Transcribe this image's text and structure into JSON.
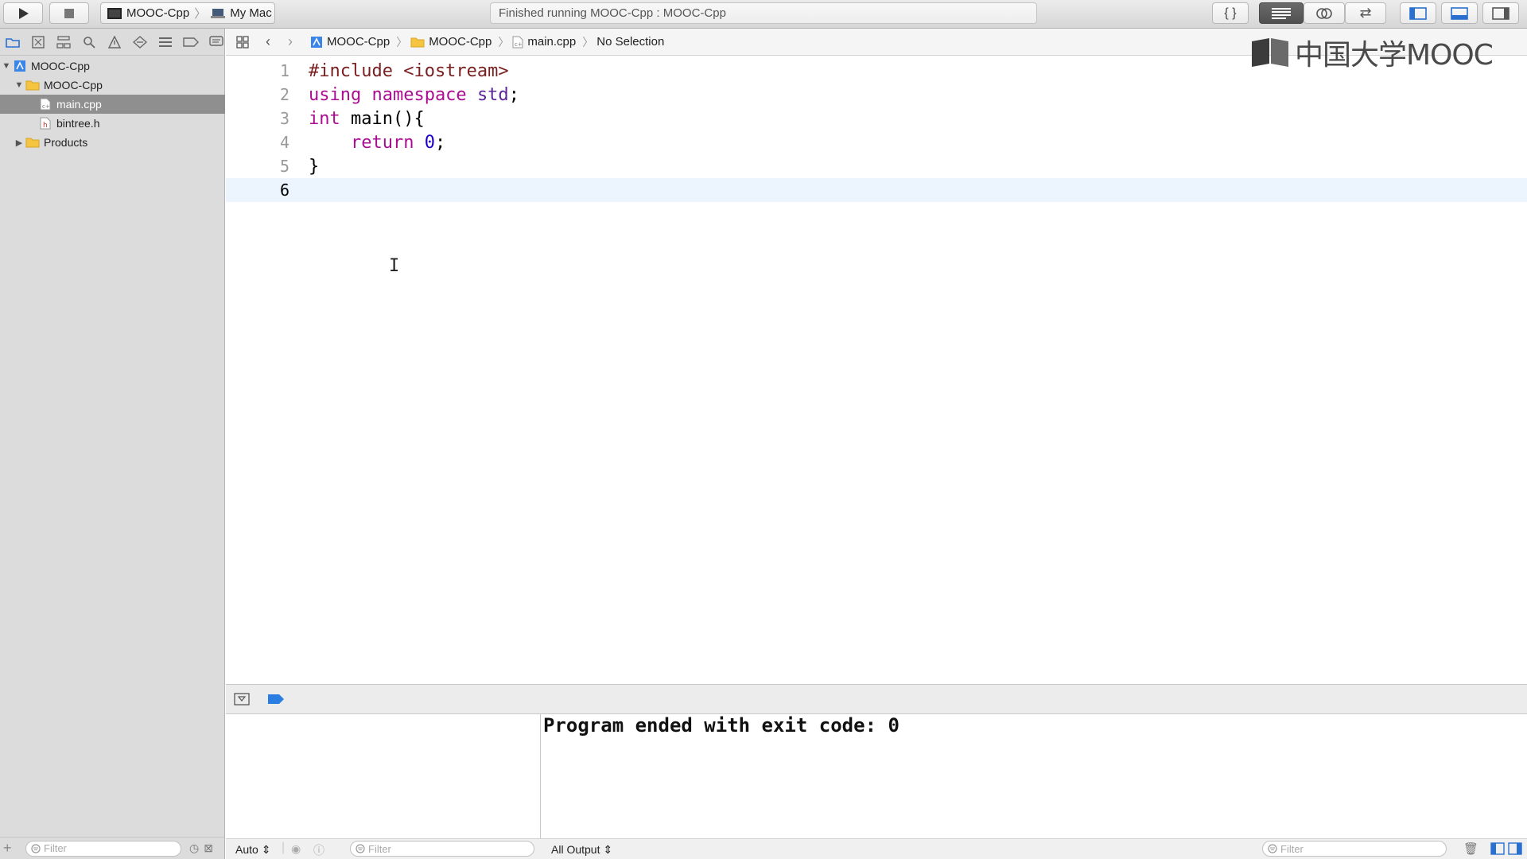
{
  "toolbar": {
    "scheme_target": "MOOC-Cpp",
    "destination": "My Mac",
    "activity_status": "Finished running MOOC-Cpp : MOOC-Cpp"
  },
  "navigator": {
    "tree": [
      {
        "label": "MOOC-Cpp",
        "kind": "project",
        "expanded": true
      },
      {
        "label": "MOOC-Cpp",
        "kind": "folder",
        "expanded": true
      },
      {
        "label": "main.cpp",
        "kind": "cpp-file",
        "selected": true
      },
      {
        "label": "bintree.h",
        "kind": "header-file"
      },
      {
        "label": "Products",
        "kind": "folder",
        "expanded": false
      }
    ],
    "filter_placeholder": "Filter"
  },
  "jumpbar": {
    "crumbs": [
      "MOOC-Cpp",
      "MOOC-Cpp",
      "main.cpp",
      "No Selection"
    ]
  },
  "editor": {
    "line_numbers": [
      "1",
      "2",
      "3",
      "4",
      "5",
      "6"
    ],
    "current_line": 6
  },
  "watermark": {
    "text": "中国大学MOOC"
  },
  "debug": {
    "console_output": "Program ended with exit code: 0",
    "variables_scope": "Auto ⇕",
    "variables_filter_placeholder": "Filter",
    "console_scope": "All Output ⇕",
    "console_filter_placeholder": "Filter"
  },
  "colors": {
    "keyword": "#aa0d91",
    "preprocessor": "#7a1f1f",
    "number": "#1c00cf",
    "type": "#5c2699",
    "current_line_bg": "#ecf5fe",
    "selection_bg": "#8f8f8f"
  }
}
